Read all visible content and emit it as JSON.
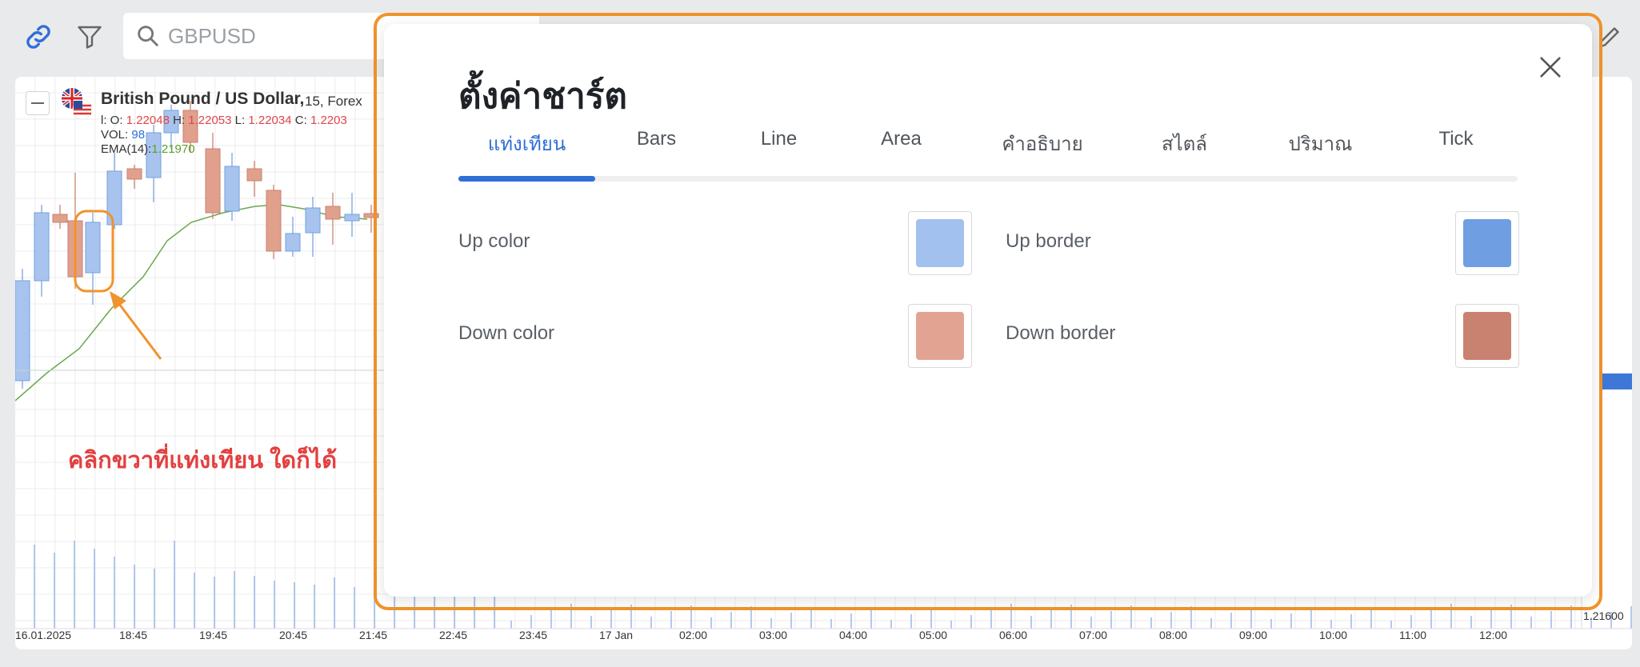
{
  "toolbar": {
    "link_icon": "link-icon",
    "filter_icon": "filter-icon",
    "search_icon": "search-icon",
    "search_value": "GBPUSD",
    "edit_icon": "pencil-icon"
  },
  "chart": {
    "symbol_title": "British Pound / US Dollar,",
    "interval": "15, Forex",
    "ohlc": {
      "o_label": "l: O:",
      "o": "1.22048",
      "h_label": "H:",
      "h": "1.22053",
      "l_label": "L:",
      "l": "1.22034",
      "c_label": "C:",
      "c": "1.2203"
    },
    "vol_label": "VOL:",
    "vol": "98",
    "ema_label": "EMA(14):",
    "ema": "1.21970",
    "annotation": "คลิกขวาที่แท่งเทียน ใดก็ได้",
    "price_label": "1.21600",
    "x_labels": [
      "16.01.2025",
      "18:45",
      "19:45",
      "20:45",
      "21:45",
      "22:45",
      "23:45",
      "17 Jan",
      "02:00",
      "03:00",
      "04:00",
      "05:00",
      "06:00",
      "07:00",
      "08:00",
      "09:00",
      "10:00",
      "11:00",
      "12:00"
    ],
    "colors": {
      "up": "#a8c4ee",
      "down": "#e0a08c",
      "ema": "#6aa84f",
      "annotation": "#e43f3f",
      "highlight": "#f0932b"
    }
  },
  "dialog": {
    "title": "ตั้งค่าชาร์ต",
    "close_icon": "close-icon",
    "tabs": [
      "แท่งเทียน",
      "Bars",
      "Line",
      "Area",
      "คำอธิบาย",
      "สไตล์",
      "ปริมาณ",
      "Tick"
    ],
    "active_tab": "แท่งเทียน",
    "settings": {
      "up_color_label": "Up color",
      "up_border_label": "Up border",
      "down_color_label": "Down color",
      "down_border_label": "Down border",
      "up_color": "#a3c1ee",
      "up_border": "#6f9fe2",
      "down_color": "#e3a392",
      "down_border": "#c9826f"
    }
  }
}
